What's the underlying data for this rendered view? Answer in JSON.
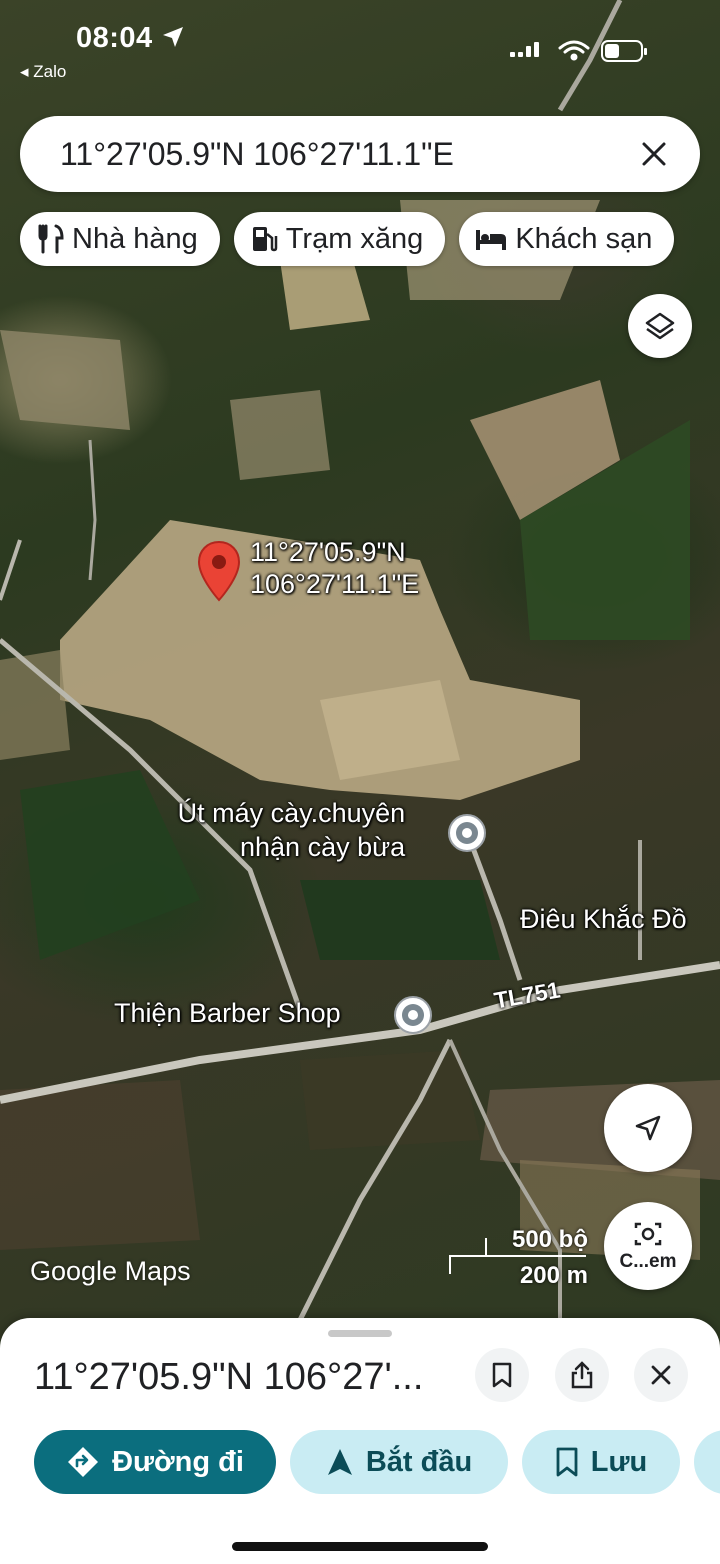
{
  "status_bar": {
    "time": "08:04",
    "back_app": "◂ Zalo"
  },
  "search": {
    "query": "11°27'05.9\"N 106°27'11.1\"E"
  },
  "chips": [
    {
      "label": "Nhà hàng",
      "icon": "restaurant-icon"
    },
    {
      "label": "Trạm xăng",
      "icon": "gas-station-icon"
    },
    {
      "label": "Khách sạn",
      "icon": "hotel-icon"
    }
  ],
  "map": {
    "pin_label_line1": "11°27'05.9\"N",
    "pin_label_line2": "106°27'11.1\"E",
    "places": {
      "plow_line1": "Út máy cày.chuyên",
      "plow_line2": "nhận cày bừa",
      "barber": "Thiện Barber Shop",
      "carving": "Điêu Khắc Đồ"
    },
    "road": "TL751",
    "logo": "Google Maps",
    "scale_top": "500 bộ",
    "scale_bottom": "200 m",
    "lens_label": "C...em",
    "pin_color": "#ea4335"
  },
  "sheet": {
    "title": "11°27'05.9\"N 106°27'...",
    "actions": {
      "directions": "Đường đi",
      "start": "Bắt đầu",
      "save": "Lưu"
    }
  },
  "colors": {
    "primary": "#0b6e7e",
    "secondary_bg": "#c9ecf3"
  }
}
